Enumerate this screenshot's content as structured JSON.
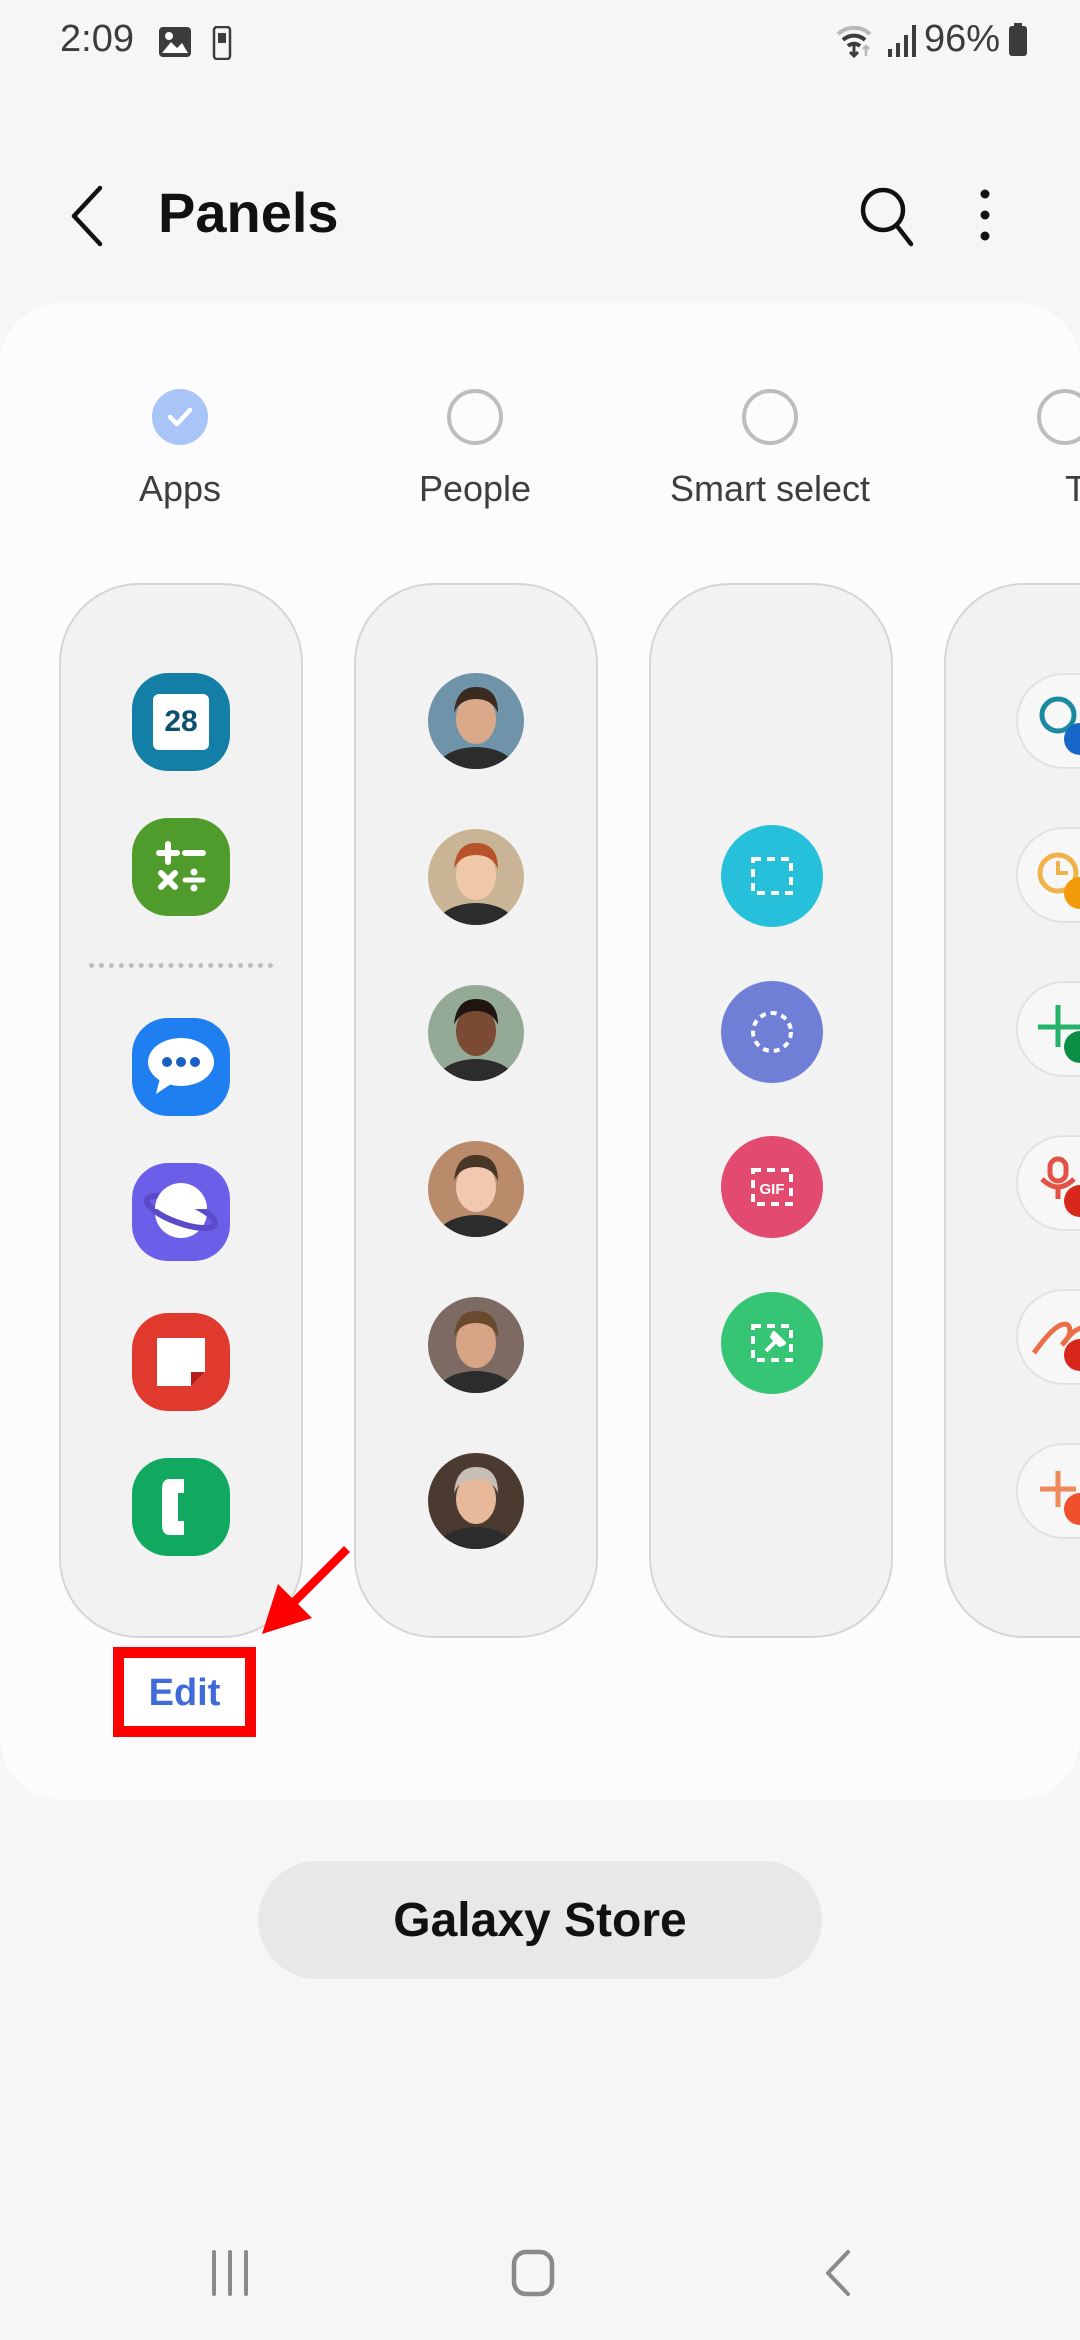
{
  "status_bar": {
    "time": "2:09",
    "notification_icons": [
      "gallery-icon",
      "phone-device-icon"
    ],
    "battery": "96%",
    "system_icons": [
      "wifi-icon",
      "signal-icon",
      "battery-icon"
    ]
  },
  "app_bar": {
    "title": "Panels",
    "back_icon": "back-chevron-icon",
    "search_icon": "search-icon",
    "more_icon": "more-options-icon"
  },
  "panels": [
    {
      "label": "Apps",
      "checked": true
    },
    {
      "label": "People",
      "checked": false
    },
    {
      "label": "Smart select",
      "checked": false
    },
    {
      "label": "Tasks",
      "checked": false
    }
  ],
  "apps_panel": {
    "apps": [
      {
        "name": "Calendar",
        "icon": "calendar-icon",
        "text": "28",
        "color": "#137ea6"
      },
      {
        "name": "Calculator",
        "icon": "calculator-icon",
        "text": "+ −\n× ÷",
        "color": "#4f9b2c"
      },
      {
        "name": "Messages",
        "icon": "messages-icon",
        "color": "#1f7ef0"
      },
      {
        "name": "Internet",
        "icon": "internet-icon",
        "color": "#6b5ee8"
      },
      {
        "name": "Samsung Notes",
        "icon": "notes-icon",
        "color": "#e03a2e"
      },
      {
        "name": "Phone",
        "icon": "phone-icon",
        "color": "#11a860"
      }
    ]
  },
  "people_panel": {
    "contacts": [
      {
        "icon": "contact-avatar-1",
        "bg": "#6f93a8",
        "skin": "#d9a98a",
        "hair": "#3b2a20"
      },
      {
        "icon": "contact-avatar-2",
        "bg": "#c9b595",
        "skin": "#f0c8a8",
        "hair": "#b8522a"
      },
      {
        "icon": "contact-avatar-3",
        "bg": "#94aa96",
        "skin": "#7a4a32",
        "hair": "#1f1410"
      },
      {
        "icon": "contact-avatar-4",
        "bg": "#b98b6a",
        "skin": "#f2c9b0",
        "hair": "#4a3626"
      },
      {
        "icon": "contact-avatar-5",
        "bg": "#7d6a62",
        "skin": "#d8a486",
        "hair": "#6a4a2c"
      },
      {
        "icon": "contact-avatar-6",
        "bg": "#4a3a30",
        "skin": "#e8b89a",
        "hair": "#c7bfb5"
      }
    ]
  },
  "smart_select_panel": {
    "tools": [
      {
        "name": "Rectangle",
        "icon": "rectangle-select-icon",
        "color": "#27c0db"
      },
      {
        "name": "Oval",
        "icon": "oval-select-icon",
        "color": "#6f7fd6"
      },
      {
        "name": "Animation",
        "icon": "gif-select-icon",
        "text": "GIF",
        "color": "#e24a70"
      },
      {
        "name": "Pin to screen",
        "icon": "pin-select-icon",
        "color": "#35c575"
      }
    ]
  },
  "tasks_panel": {
    "tasks": [
      {
        "icon": "search-task-icon",
        "color": "#1a8aa0",
        "badge": "#1667c7"
      },
      {
        "icon": "clock-task-icon",
        "color": "#f0b24a",
        "badge": "#f39a0a"
      },
      {
        "icon": "add-contact-task-icon",
        "color": "#23b46a",
        "badge": "#0a8d45"
      },
      {
        "icon": "voice-record-task-icon",
        "color": "#e35245",
        "badge": "#d8281c"
      },
      {
        "icon": "signature-task-icon",
        "color": "#ec6d4a",
        "badge": "#d8281c"
      },
      {
        "icon": "add-task-icon",
        "color": "#ee8a5a",
        "badge": "#f0502c"
      }
    ]
  },
  "edit_label": "Edit",
  "store_button": "Galaxy Store",
  "annotation": {
    "color": "#ff0000"
  },
  "nav_bar": {
    "recents_icon": "recents-icon",
    "home_icon": "home-icon",
    "back_icon": "nav-back-icon"
  }
}
